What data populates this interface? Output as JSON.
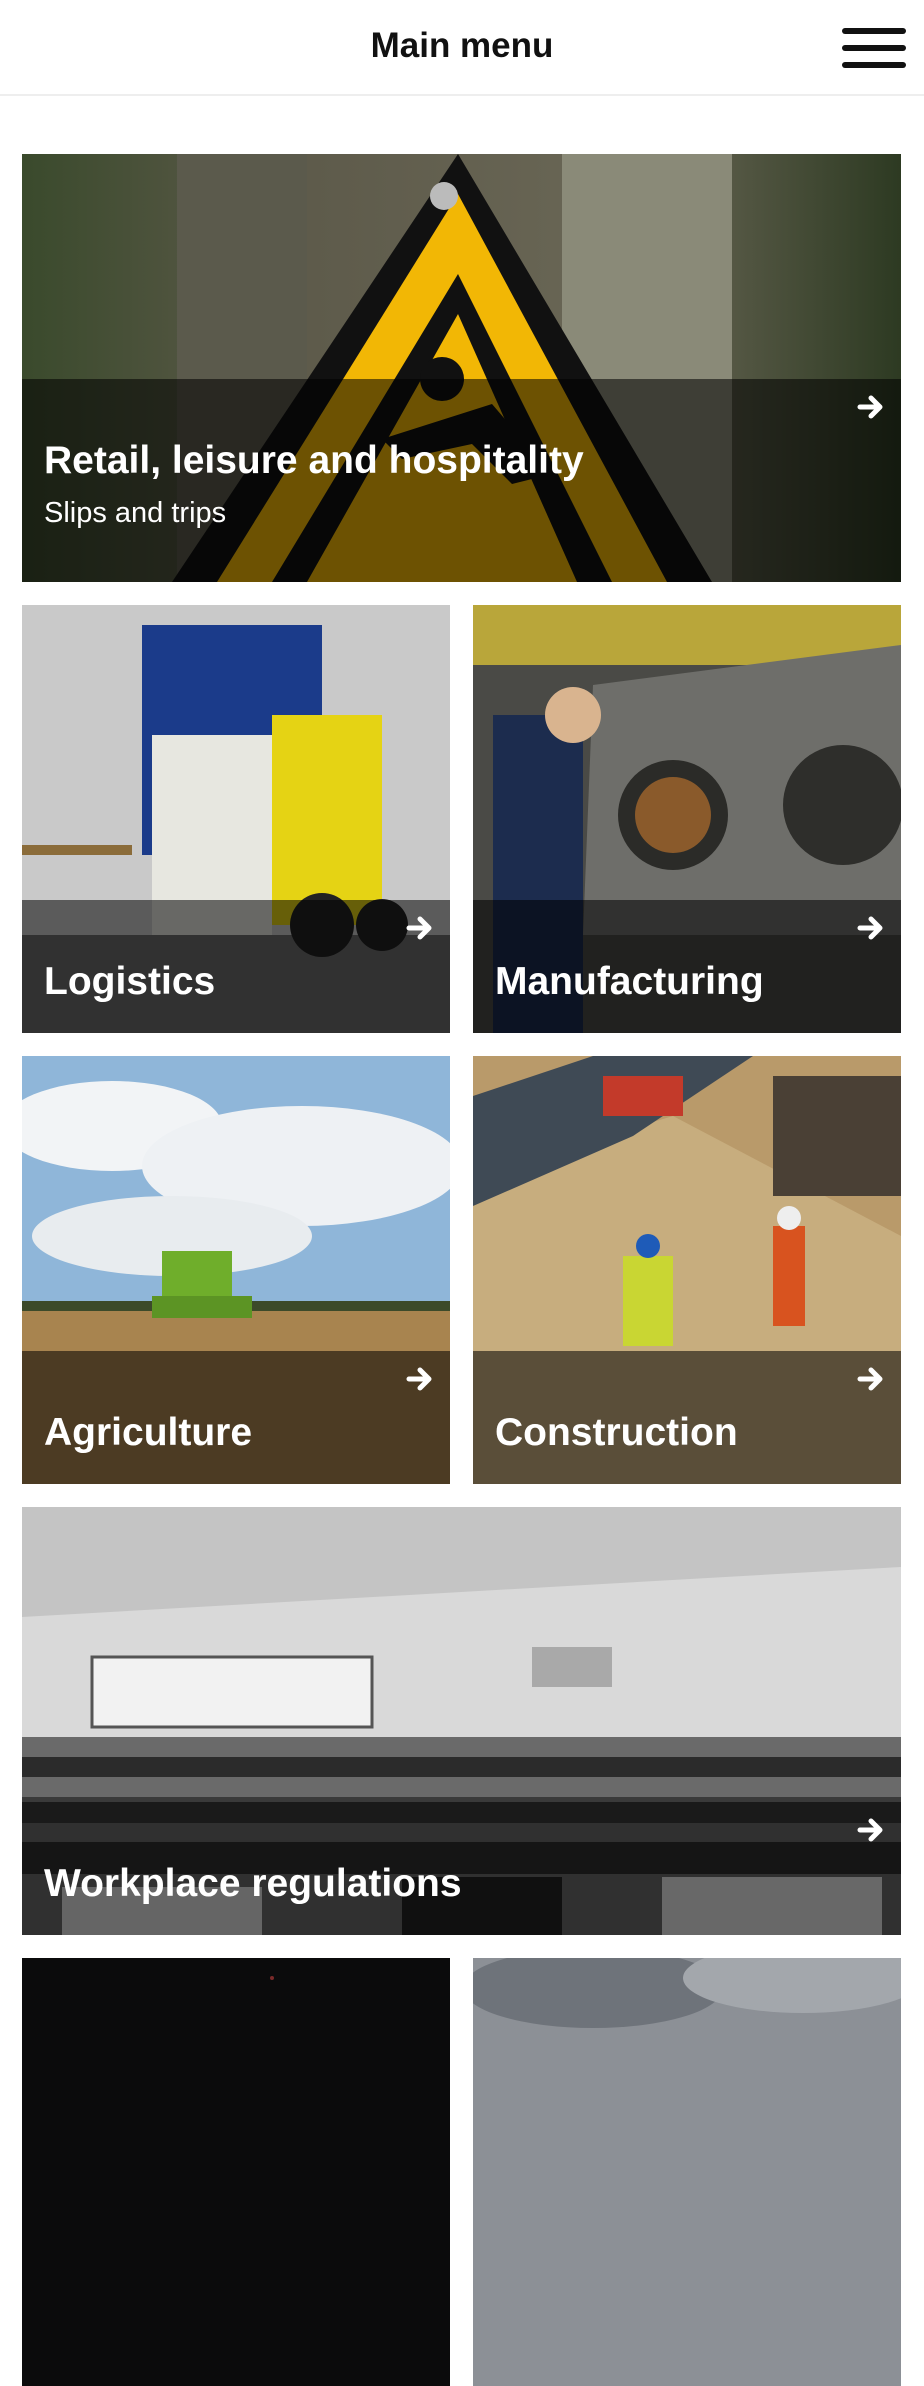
{
  "header": {
    "title": "Main menu",
    "menu_icon": "hamburger-menu-icon"
  },
  "tiles": [
    {
      "title": "Retail, leisure and hospitality",
      "subtitle": "Slips and trips",
      "icon": "arrow-right-icon"
    },
    {
      "title": "Logistics",
      "icon": "arrow-right-icon"
    },
    {
      "title": "Manufacturing",
      "icon": "arrow-right-icon"
    },
    {
      "title": "Agriculture",
      "icon": "arrow-right-icon"
    },
    {
      "title": "Construction",
      "icon": "arrow-right-icon"
    },
    {
      "title": "Workplace regulations",
      "icon": "arrow-right-icon"
    }
  ],
  "colors": {
    "header_text": "#111111",
    "tile_overlay": "rgba(0,0,0,0.55)",
    "tile_text": "#ffffff",
    "warning_yellow": "#f2b705"
  }
}
